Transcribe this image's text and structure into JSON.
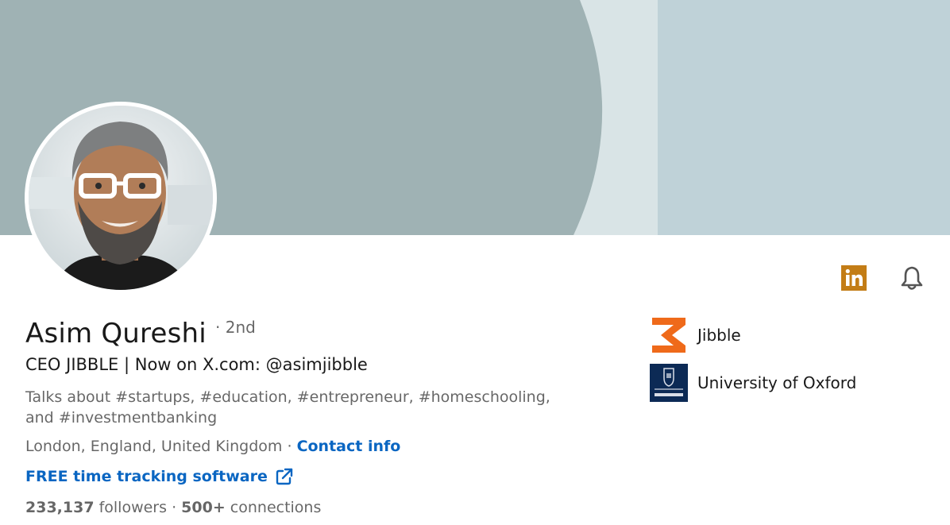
{
  "profile": {
    "name": "Asim Qureshi",
    "degree": "· 2nd",
    "headline": "CEO JIBBLE | Now on X.com: @asimjibble",
    "talks_about": "Talks about #startups, #education, #entrepreneur, #homeschooling, and #investmentbanking",
    "location": "London, England, United Kingdom",
    "location_sep": " · ",
    "contact_info_label": "Contact info",
    "website_label": "FREE time tracking software",
    "followers_count": "233,137",
    "followers_label": " followers",
    "connections_sep": " · ",
    "connections_count": "500+",
    "connections_label": " connections"
  },
  "organizations": [
    {
      "label": "Jibble",
      "logo": "jibble-logo"
    },
    {
      "label": "University of Oxford",
      "logo": "oxford-logo"
    }
  ],
  "icons": {
    "linkedin": "linkedin-icon",
    "notifications": "bell-icon",
    "external_link": "external-link-icon"
  },
  "colors": {
    "link": "#0a66c2",
    "linkedin_badge": "#c37d16",
    "jibble_orange": "#ef6a1a",
    "oxford_blue": "#0c2a55",
    "cover_left": "#9fb2b4",
    "cover_right": "#bfd2d8"
  }
}
